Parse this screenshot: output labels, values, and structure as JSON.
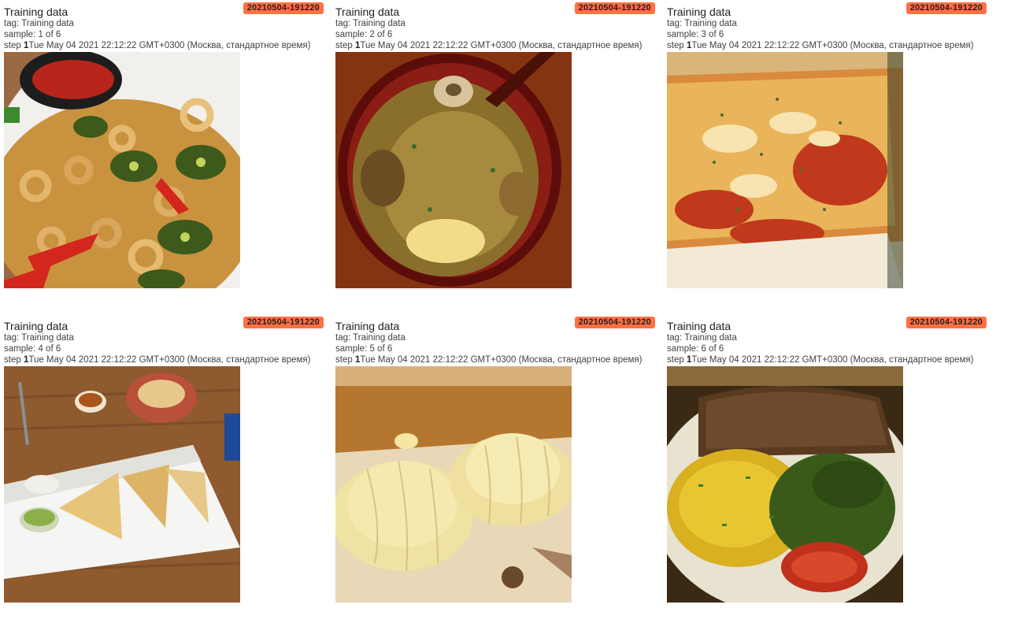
{
  "cards": [
    {
      "title": "Training data",
      "run": "20210504-191220",
      "tag": "tag: Training data",
      "sample": "sample: 1 of 6",
      "step_label": "step ",
      "step_value": "1",
      "timestamp": "Tue May 04 2021 22:12:22 GMT+0300 (Москва, стандартное время)",
      "image_subject": "calamari-with-jalapenos"
    },
    {
      "title": "Training data",
      "run": "20210504-191220",
      "tag": "tag: Training data",
      "sample": "sample: 2 of 6",
      "step_label": "step ",
      "step_value": "1",
      "timestamp": "Tue May 04 2021 22:12:22 GMT+0300 (Москва, стандартное время)",
      "image_subject": "miso-soup-bowl"
    },
    {
      "title": "Training data",
      "run": "20210504-191220",
      "tag": "tag: Training data",
      "sample": "sample: 3 of 6",
      "step_label": "step ",
      "step_value": "1",
      "timestamp": "Tue May 04 2021 22:12:22 GMT+0300 (Москва, стандартное время)",
      "image_subject": "cheese-pizza"
    },
    {
      "title": "Training data",
      "run": "20210504-191220",
      "tag": "tag: Training data",
      "sample": "sample: 4 of 6",
      "step_label": "step ",
      "step_value": "1",
      "timestamp": "Tue May 04 2021 22:12:22 GMT+0300 (Москва, стандартное время)",
      "image_subject": "quesadilla-plate"
    },
    {
      "title": "Training data",
      "run": "20210504-191220",
      "tag": "tag: Training data",
      "sample": "sample: 5 of 6",
      "step_label": "step ",
      "step_value": "1",
      "timestamp": "Tue May 04 2021 22:12:22 GMT+0300 (Москва, стандартное время)",
      "image_subject": "steamed-dumplings"
    },
    {
      "title": "Training data",
      "run": "20210504-191220",
      "tag": "tag: Training data",
      "sample": "sample: 6 of 6",
      "step_label": "step ",
      "step_value": "1",
      "timestamp": "Tue May 04 2021 22:12:22 GMT+0300 (Москва, стандартное время)",
      "image_subject": "omelette-with-bread"
    }
  ],
  "colors": {
    "run_chip": "#ff7043",
    "text": "#212121",
    "meta_text": "#424242"
  }
}
